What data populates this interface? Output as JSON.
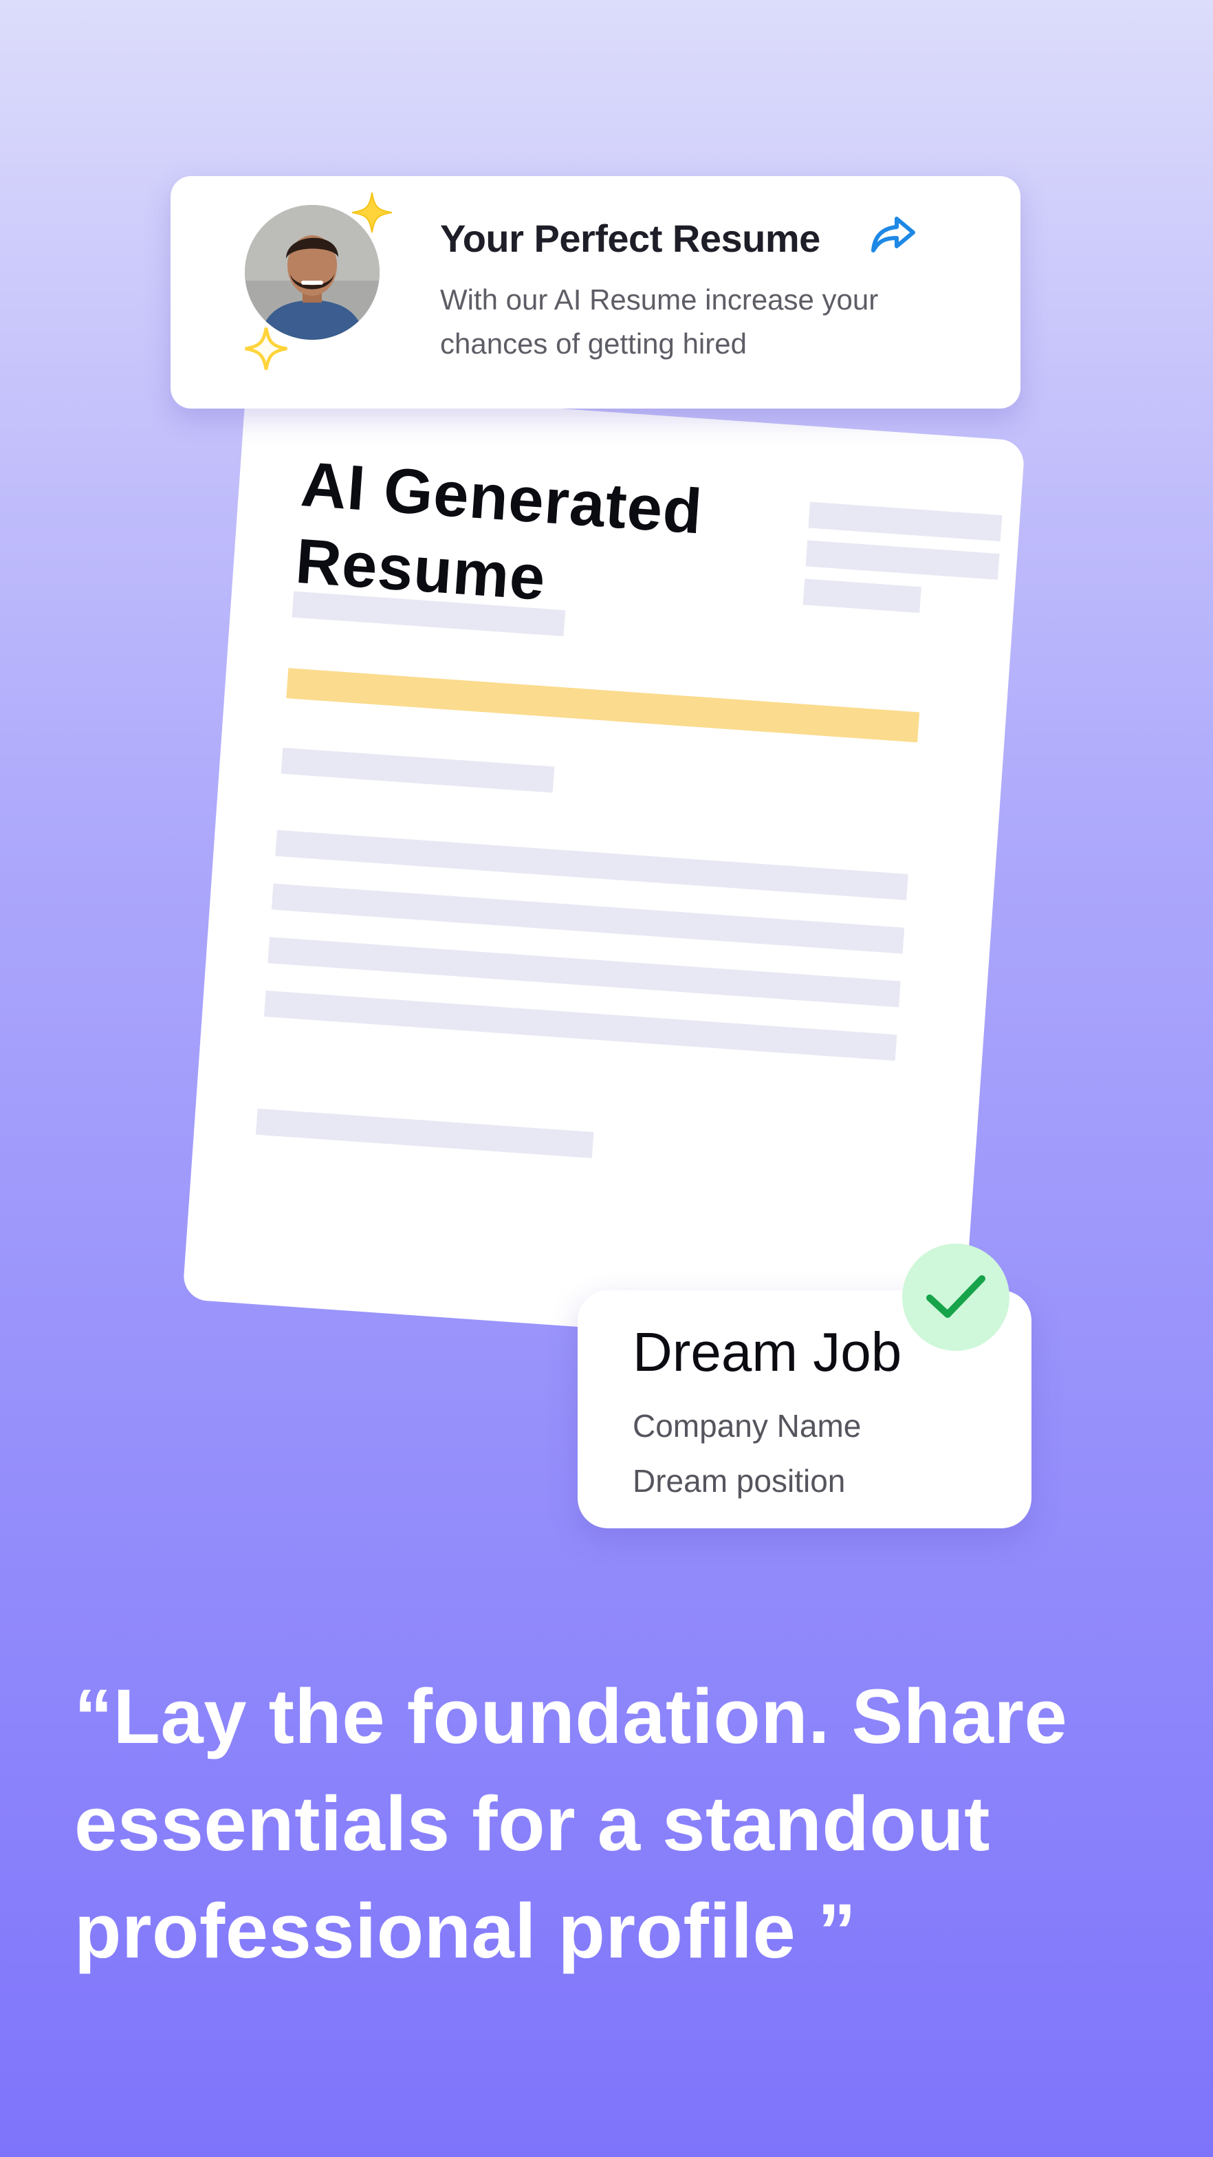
{
  "top_card": {
    "title": "Your Perfect Resume",
    "description": "With our AI Resume increase your chances of getting hired",
    "share_icon": "share-arrow-icon",
    "avatar_icon": "person-avatar",
    "sparkle_icon": "sparkle-star"
  },
  "resume": {
    "heading_line_1": "AI Generated",
    "heading_line_2": "Resume"
  },
  "dream_card": {
    "title": "Dream Job",
    "company": "Company Name",
    "position": "Dream position",
    "check_icon": "checkmark-icon"
  },
  "quote": "“Lay the foundation. Share essentials for a standout professional profile ”",
  "colors": {
    "accent_purple": "#7e74fb",
    "highlight_yellow": "#fbdb8d",
    "sparkle_yellow": "#ffd43b",
    "check_green": "#16a34a",
    "share_blue": "#1e88e5"
  }
}
